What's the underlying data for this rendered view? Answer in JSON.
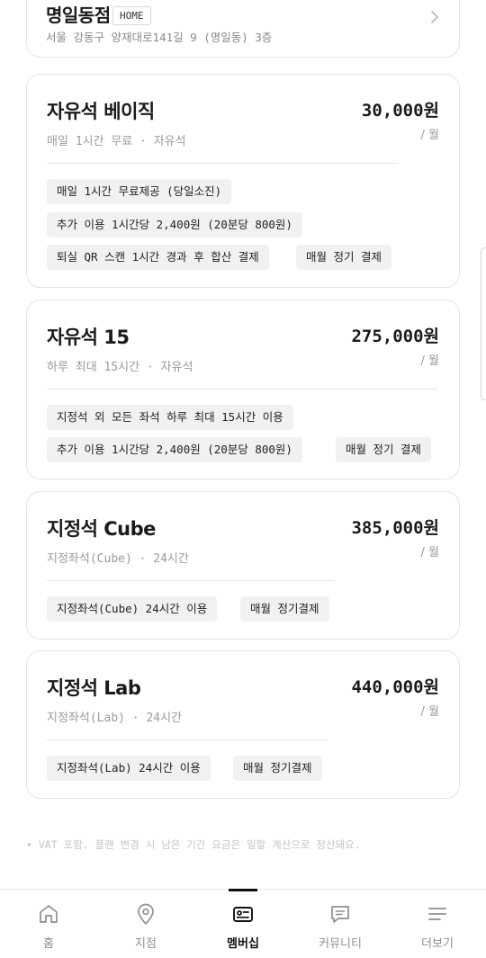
{
  "branch": {
    "name": "명일동점",
    "badge": "HOME",
    "address": "서울 강동구 양재대로141길 9 (명일동) 3층",
    "chevron_icon": "chevron-right-icon"
  },
  "plans": [
    {
      "title": "자유석 베이직",
      "price": "30,000원",
      "unit": "/ 월",
      "sub": "매일 1시간 무료 · 자유석",
      "tags": [
        "매일 1시간 무료제공 (당일소진)",
        "추가 이용 1시간당 2,400원 (20분당 800원)",
        "퇴실 QR 스캔 1시간 경과 후 합산 결제",
        "매월 정기 결제"
      ]
    },
    {
      "title": "자유석 15",
      "price": "275,000원",
      "unit": "/ 월",
      "sub": "하루 최대 15시간 · 자유석",
      "tags": [
        "지정석 외 모든 좌석 하루 최대 15시간 이용",
        "추가 이용 1시간당 2,400원 (20분당 800원)",
        "매월 정기 결제"
      ]
    },
    {
      "title": "지정석 Cube",
      "price": "385,000원",
      "unit": "/ 월",
      "sub": "지정좌석(Cube) · 24시간",
      "tags": [
        "지정좌석(Cube) 24시간 이용",
        "매월 정기결제"
      ]
    },
    {
      "title": "지정석 Lab",
      "price": "440,000원",
      "unit": "/ 월",
      "sub": "지정좌석(Lab) · 24시간",
      "tags": [
        "지정좌석(Lab) 24시간 이용",
        "매월 정기결제"
      ]
    }
  ],
  "footnote": "• VAT 포함. 플랜 변경 시 남은 기간 요금은 일할 계산으로 정산돼요.",
  "nav": [
    {
      "label": "홈",
      "icon": "home-icon",
      "active": false
    },
    {
      "label": "지점",
      "icon": "map-pin-icon",
      "active": false
    },
    {
      "label": "멤버십",
      "icon": "membership-card-icon",
      "active": true
    },
    {
      "label": "커뮤니티",
      "icon": "chat-bubble-icon",
      "active": false
    },
    {
      "label": "더보기",
      "icon": "menu-icon",
      "active": false
    }
  ]
}
